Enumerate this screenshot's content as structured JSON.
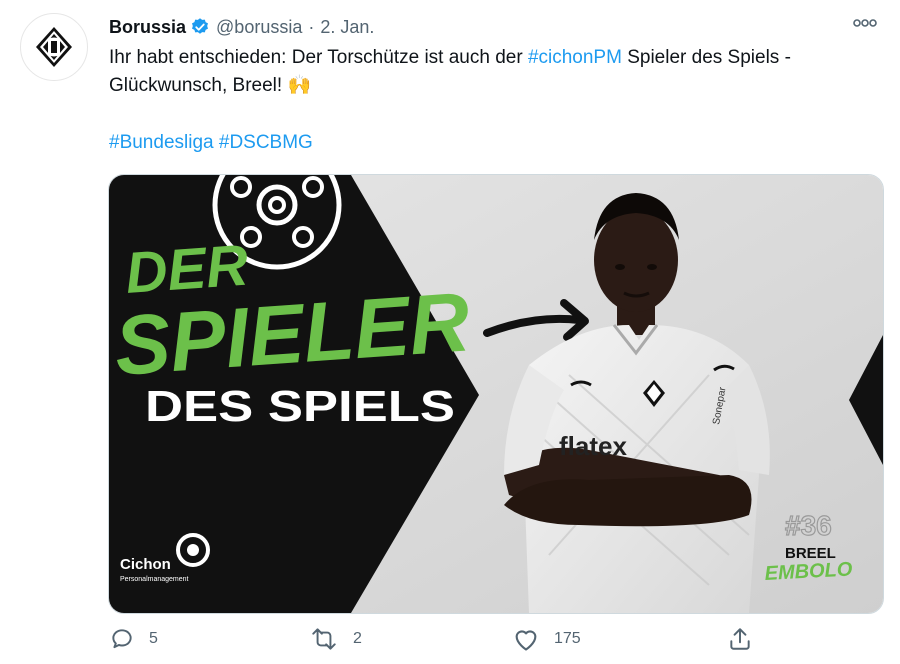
{
  "tweet": {
    "author_name": "Borussia",
    "handle": "@borussia",
    "separator": "·",
    "date": "2. Jan.",
    "text_before": "Ihr habt entschieden: Der Torschütze ist auch der ",
    "hashtag_inline": "#cichonPM",
    "text_after": " Spieler des Spiels - Glückwunsch, Breel! ",
    "emoji": "🙌",
    "hashtags": [
      "#Bundesliga",
      "#DSCBMG"
    ]
  },
  "image": {
    "headline_1": "DER",
    "headline_2": "SPIELER",
    "headline_3": "DES SPIELS",
    "sponsor_name": "Cichon",
    "sponsor_sub": "Personalmanagement",
    "player_number": "#36",
    "player_first": "BREEL",
    "player_last": "EMBOLO",
    "jersey_sponsor": "flatex",
    "sleeve_text": "Sonepar",
    "colors": {
      "green": "#6cc04a",
      "dark": "#111111",
      "bg": "#dcdcdc"
    }
  },
  "actions": {
    "replies": "5",
    "retweets": "2",
    "likes": "175"
  },
  "icons": [
    "club-logo-icon",
    "verified-icon",
    "more-icon",
    "reply-icon",
    "retweet-icon",
    "like-icon",
    "share-icon"
  ],
  "colors": {
    "link": "#1d9bf0",
    "secondary_text": "#536471",
    "verified": "#1d9bf0"
  }
}
